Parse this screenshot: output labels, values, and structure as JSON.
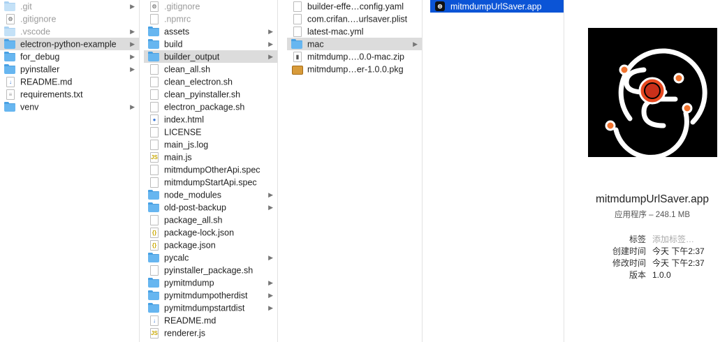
{
  "columns": [
    {
      "items": [
        {
          "label": ".git",
          "icon": "folder-icon",
          "style": "dim",
          "arrow": true
        },
        {
          "label": ".gitignore",
          "icon": "gear-file-icon",
          "style": "dim",
          "arrow": false
        },
        {
          "label": ".vscode",
          "icon": "folder-icon",
          "style": "dim",
          "arrow": true
        },
        {
          "label": "electron-python-example",
          "icon": "folder-icon",
          "style": "hl",
          "arrow": true
        },
        {
          "label": "for_debug",
          "icon": "folder-icon",
          "style": "",
          "arrow": true
        },
        {
          "label": "pyinstaller",
          "icon": "folder-icon",
          "style": "",
          "arrow": true
        },
        {
          "label": "README.md",
          "icon": "markdown-file-icon",
          "style": "",
          "arrow": false
        },
        {
          "label": "requirements.txt",
          "icon": "text-file-icon",
          "style": "",
          "arrow": false
        },
        {
          "label": "venv",
          "icon": "folder-icon",
          "style": "",
          "arrow": true
        }
      ]
    },
    {
      "items": [
        {
          "label": ".gitignore",
          "icon": "gear-file-icon",
          "style": "dim",
          "arrow": false
        },
        {
          "label": ".npmrc",
          "icon": "document-icon",
          "style": "dim",
          "arrow": false
        },
        {
          "label": "assets",
          "icon": "folder-icon",
          "style": "",
          "arrow": true
        },
        {
          "label": "build",
          "icon": "folder-icon",
          "style": "",
          "arrow": true
        },
        {
          "label": "builder_output",
          "icon": "folder-icon",
          "style": "hl",
          "arrow": true
        },
        {
          "label": "clean_all.sh",
          "icon": "document-icon",
          "style": "",
          "arrow": false
        },
        {
          "label": "clean_electron.sh",
          "icon": "document-icon",
          "style": "",
          "arrow": false
        },
        {
          "label": "clean_pyinstaller.sh",
          "icon": "document-icon",
          "style": "",
          "arrow": false
        },
        {
          "label": "electron_package.sh",
          "icon": "document-icon",
          "style": "",
          "arrow": false
        },
        {
          "label": "index.html",
          "icon": "html-file-icon",
          "style": "",
          "arrow": false
        },
        {
          "label": "LICENSE",
          "icon": "document-icon",
          "style": "",
          "arrow": false
        },
        {
          "label": "main_js.log",
          "icon": "document-icon",
          "style": "",
          "arrow": false
        },
        {
          "label": "main.js",
          "icon": "js-file-icon",
          "style": "",
          "arrow": false
        },
        {
          "label": "mitmdumpOtherApi.spec",
          "icon": "document-icon",
          "style": "",
          "arrow": false
        },
        {
          "label": "mitmdumpStartApi.spec",
          "icon": "document-icon",
          "style": "",
          "arrow": false
        },
        {
          "label": "node_modules",
          "icon": "folder-icon",
          "style": "",
          "arrow": true
        },
        {
          "label": "old-post-backup",
          "icon": "folder-icon",
          "style": "",
          "arrow": true
        },
        {
          "label": "package_all.sh",
          "icon": "document-icon",
          "style": "",
          "arrow": false
        },
        {
          "label": "package-lock.json",
          "icon": "json-file-icon",
          "style": "",
          "arrow": false
        },
        {
          "label": "package.json",
          "icon": "json-file-icon",
          "style": "",
          "arrow": false
        },
        {
          "label": "pycalc",
          "icon": "folder-icon",
          "style": "",
          "arrow": true
        },
        {
          "label": "pyinstaller_package.sh",
          "icon": "document-icon",
          "style": "",
          "arrow": false
        },
        {
          "label": "pymitmdump",
          "icon": "folder-icon",
          "style": "",
          "arrow": true
        },
        {
          "label": "pymitmdumpotherdist",
          "icon": "folder-icon",
          "style": "",
          "arrow": true
        },
        {
          "label": "pymitmdumpstartdist",
          "icon": "folder-icon",
          "style": "",
          "arrow": true
        },
        {
          "label": "README.md",
          "icon": "markdown-file-icon",
          "style": "",
          "arrow": false
        },
        {
          "label": "renderer.js",
          "icon": "js-file-icon",
          "style": "",
          "arrow": false
        }
      ]
    },
    {
      "items": [
        {
          "label": "builder-effe…config.yaml",
          "icon": "document-icon",
          "style": "",
          "arrow": false
        },
        {
          "label": "com.crifan.…urlsaver.plist",
          "icon": "document-icon",
          "style": "",
          "arrow": false
        },
        {
          "label": "latest-mac.yml",
          "icon": "document-icon",
          "style": "",
          "arrow": false
        },
        {
          "label": "mac",
          "icon": "folder-icon",
          "style": "hl",
          "arrow": true
        },
        {
          "label": "mitmdump….0.0-mac.zip",
          "icon": "zip-file-icon",
          "style": "",
          "arrow": false
        },
        {
          "label": "mitmdump…er-1.0.0.pkg",
          "icon": "package-icon",
          "style": "",
          "arrow": false
        }
      ]
    },
    {
      "items": [
        {
          "label": "mitmdumpUrlSaver.app",
          "icon": "app-icon",
          "style": "sel",
          "arrow": false
        }
      ]
    }
  ],
  "preview": {
    "name": "mitmdumpUrlSaver.app",
    "subtitle": "应用程序 – 248.1 MB",
    "tags_label": "标签",
    "tags_placeholder": "添加标签…",
    "created_label": "创建时间",
    "created_value": "今天 下午2:37",
    "modified_label": "修改时间",
    "modified_value": "今天 下午2:37",
    "version_label": "版本",
    "version_value": "1.0.0"
  },
  "colors": {
    "selection": "#0b54d6",
    "highlight": "#dcdcdc",
    "folder": "#67b6f0",
    "app_accent": "#e8481f"
  }
}
